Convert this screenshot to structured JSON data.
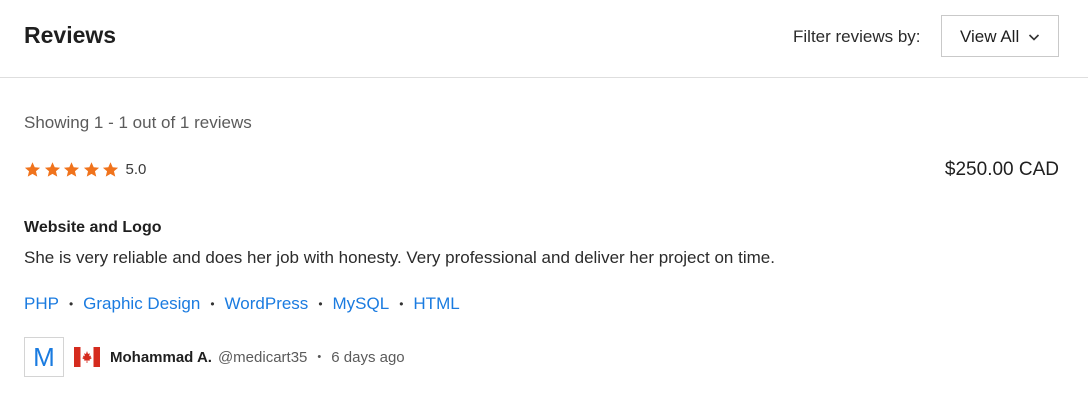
{
  "header": {
    "title": "Reviews",
    "filter_label": "Filter reviews by:",
    "filter_value": "View All"
  },
  "summary": {
    "showing": "Showing 1 - 1 out of 1 reviews"
  },
  "review": {
    "rating_stars": 5,
    "rating_value": "5.0",
    "price": "$250.00 CAD",
    "title": "Website and Logo",
    "text": "She is very reliable and does her job with honesty. Very professional and deliver her project on time.",
    "skills": [
      "PHP",
      "Graphic Design",
      "WordPress",
      "MySQL",
      "HTML"
    ],
    "reviewer": {
      "avatar_letter": "M",
      "flag": "canada-flag-icon",
      "name": "Mohammad A.",
      "handle": "@medicart35",
      "time": "6 days ago"
    }
  },
  "colors": {
    "star": "#f0731c",
    "link": "#1a7be0",
    "flag_red": "#d52b1e"
  }
}
